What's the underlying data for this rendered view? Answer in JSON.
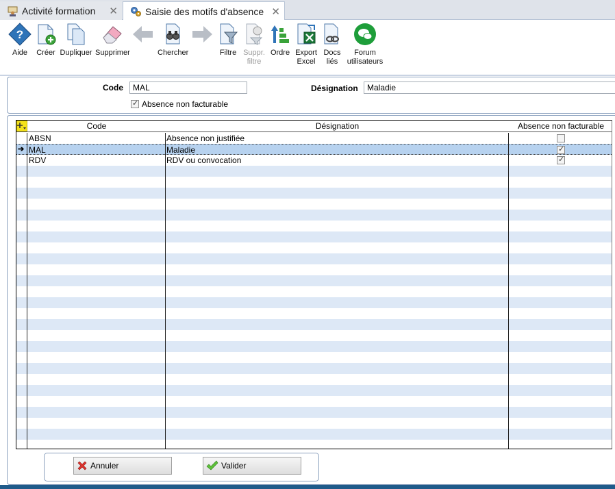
{
  "tabs": [
    {
      "label": "Activité formation",
      "active": false
    },
    {
      "label": "Saisie des motifs d'absence",
      "active": true
    }
  ],
  "toolbar": {
    "aide": "Aide",
    "creer": "Créer",
    "dupliquer": "Dupliquer",
    "supprimer": "Supprimer",
    "chercher": "Chercher",
    "filtre": "Filtre",
    "suppr_filtre_1": "Suppr.",
    "suppr_filtre_2": "filtre",
    "ordre": "Ordre",
    "export_1": "Export",
    "export_2": "Excel",
    "docs_1": "Docs",
    "docs_2": "liés",
    "forum_1": "Forum",
    "forum_2": "utilisateurs"
  },
  "form": {
    "code_label": "Code",
    "code_value": "MAL",
    "designation_label": "Désignation",
    "designation_value": "Maladie",
    "absence_label": "Absence non facturable",
    "absence_checked": true
  },
  "grid": {
    "columns": [
      "Code",
      "Désignation",
      "Absence non facturable"
    ],
    "rows": [
      {
        "code": "ABSN",
        "designation": "Absence non justifiée",
        "non_facturable": false
      },
      {
        "code": "MAL",
        "designation": "Maladie",
        "non_facturable": true,
        "selected": true
      },
      {
        "code": "RDV",
        "designation": "RDV ou convocation",
        "non_facturable": true
      }
    ]
  },
  "actions": {
    "annuler": "Annuler",
    "valider": "Valider"
  },
  "colors": {
    "row_alt": "#dde8f6",
    "row_selected": "#b7d2ef",
    "border_blue": "#8aa0bd",
    "forum_green": "#1e9e3a"
  }
}
